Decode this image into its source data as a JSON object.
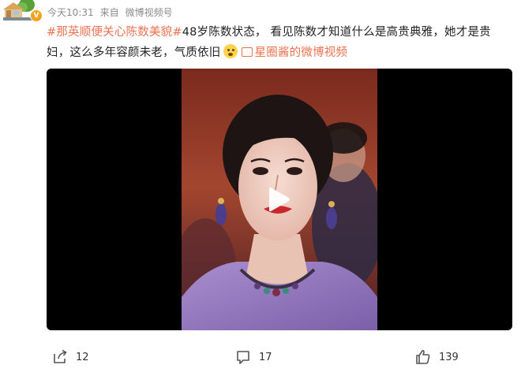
{
  "header": {
    "timestamp": "今天10:31",
    "source_prefix": "来自",
    "source": "微博视频号"
  },
  "post": {
    "hashtag": "#那英顺便关心陈数美貌#",
    "text_main": "48岁陈数状态， 看见陈数才知道什么是高贵典雅，她才是贵妇，这么多年容颜未老，气质依旧",
    "emoji": "scared-face-emoji",
    "video_link": "星圈酱的微博视频"
  },
  "video": {
    "play_icon": "play-icon"
  },
  "actions": {
    "share": {
      "icon": "share-icon",
      "count": "12"
    },
    "comment": {
      "icon": "comment-icon",
      "count": "17"
    },
    "like": {
      "icon": "thumbs-up-icon",
      "count": "139"
    }
  },
  "colors": {
    "hashtag": "#eb7350",
    "meta": "#8a8a8a",
    "badge": "#f3a21b"
  }
}
